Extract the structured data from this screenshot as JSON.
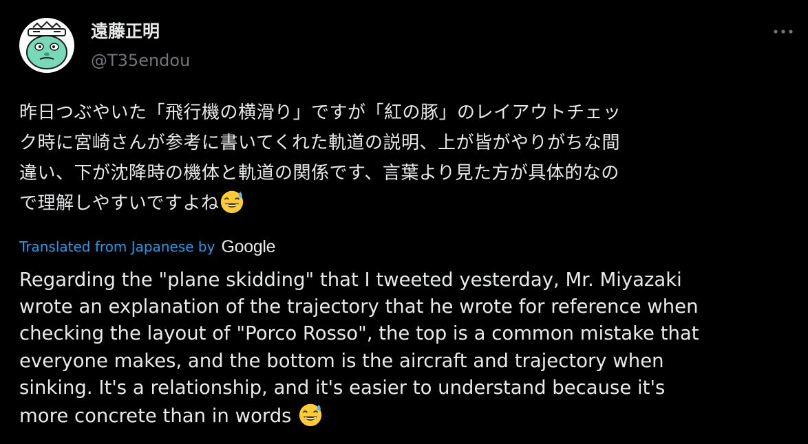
{
  "author": {
    "display_name": "遠藤正明",
    "handle": "@T35endou",
    "avatar_icon": "character-avatar-icon"
  },
  "menu": {
    "icon": "more-dots-icon",
    "glyph": "···"
  },
  "tweet": {
    "original_lines": [
      "昨日つぶやいた「飛行機の横滑り」ですが「紅の豚」のレイアウトチェッ",
      "ク時に宮崎さんが参考に書いてくれた軌道の説明、上が皆がやりがちな間",
      "違い、下が沈降時の機体と軌道の関係です、言葉より見た方が具体的なの",
      "で理解しやすいですよね"
    ],
    "emoji": "grinning-face-with-sweat-emoji"
  },
  "translation": {
    "label": "Translated from Japanese by",
    "provider": "Google",
    "lines": [
      "Regarding the \"plane skidding\" that I tweeted yesterday, Mr. Miyazaki",
      "wrote an explanation of the trajectory that he wrote for reference when",
      "checking the layout of \"Porco Rosso\", the top is a common mistake that",
      "everyone makes, and the bottom is the aircraft and trajectory when",
      "sinking. It's a relationship, and it's easier to understand because it's",
      "more concrete than in words"
    ]
  },
  "colors": {
    "background": "#000000",
    "text_primary": "#e7e9ea",
    "text_secondary": "#71767b",
    "link": "#1d9bf0"
  }
}
